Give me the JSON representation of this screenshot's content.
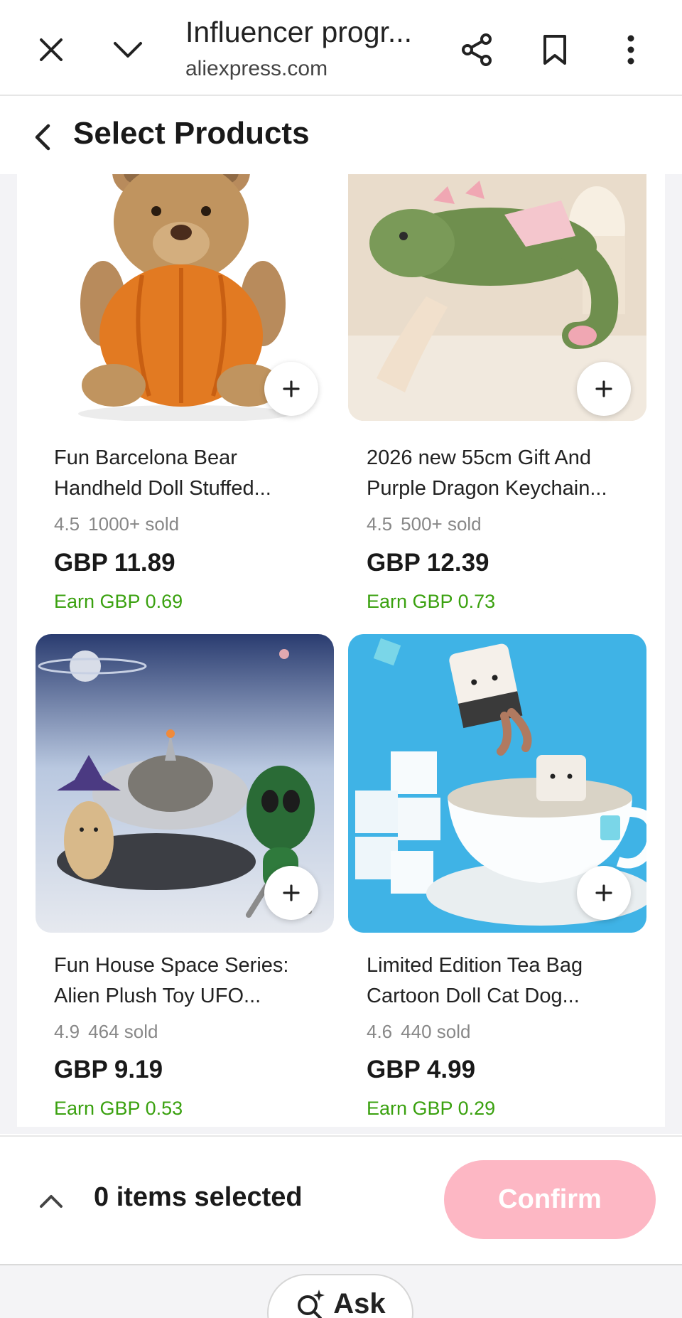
{
  "browser": {
    "title": "Influencer progr...",
    "domain": "aliexpress.com",
    "icons": [
      "close-icon",
      "chevron-down-icon",
      "share-icon",
      "bookmark-icon",
      "more-vertical-icon"
    ]
  },
  "header": {
    "title": "Select Products"
  },
  "products": [
    {
      "title_line1": "Fun Barcelona Bear",
      "title_line2": "Handheld Doll Stuffed...",
      "rating": "4.5",
      "sold": "1000+ sold",
      "price": "GBP 11.89",
      "earn": "Earn GBP 0.69"
    },
    {
      "title_line1": "2026 new 55cm Gift And",
      "title_line2": "Purple Dragon Keychain...",
      "rating": "4.5",
      "sold": "500+ sold",
      "price": "GBP 12.39",
      "earn": "Earn GBP 0.73"
    },
    {
      "title_line1": "Fun House Space Series:",
      "title_line2": "Alien Plush Toy UFO...",
      "rating": "4.9",
      "sold": "464 sold",
      "price": "GBP 9.19",
      "earn": "Earn GBP 0.53"
    },
    {
      "title_line1": "Limited Edition Tea Bag",
      "title_line2": "Cartoon Doll Cat Dog...",
      "rating": "4.6",
      "sold": "440 sold",
      "price": "GBP 4.99",
      "earn": "Earn GBP 0.29"
    }
  ],
  "selection": {
    "count_label": "0 items selected",
    "confirm_label": "Confirm"
  },
  "ask": {
    "label": "Ask"
  },
  "colors": {
    "earn_green": "#3aa10f",
    "confirm_pink": "#fdb7c4",
    "price_black": "#191919"
  }
}
